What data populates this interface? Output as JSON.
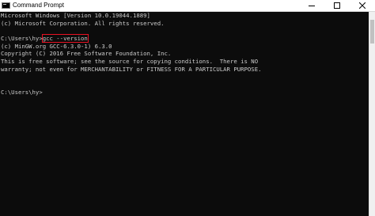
{
  "window": {
    "title": "Command Prompt"
  },
  "icons": {
    "app": "console-app-icon",
    "minimize": "minimize-icon",
    "maximize": "maximize-icon",
    "close": "close-icon"
  },
  "console": {
    "lines": [
      "Microsoft Windows [Version 10.0.19044.1889]",
      "(c) Microsoft Corporation. All rights reserved.",
      "",
      "",
      "",
      "(c) MinGW.org GCC-6.3.0-1) 6.3.0",
      "Copyright (C) 2016 Free Software Foundation, Inc.",
      "This is free software; see the source for copying conditions.  There is NO",
      "warranty; not even for MERCHANTABILITY or FITNESS FOR A PARTICULAR PURPOSE.",
      "",
      "",
      "C:\\Users\\hy>"
    ],
    "prompt": "C:\\Users\\hy>",
    "command": "gcc --version"
  },
  "colors": {
    "background": "#0c0c0c",
    "text": "#cccccc",
    "highlight_box": "#e81123"
  }
}
